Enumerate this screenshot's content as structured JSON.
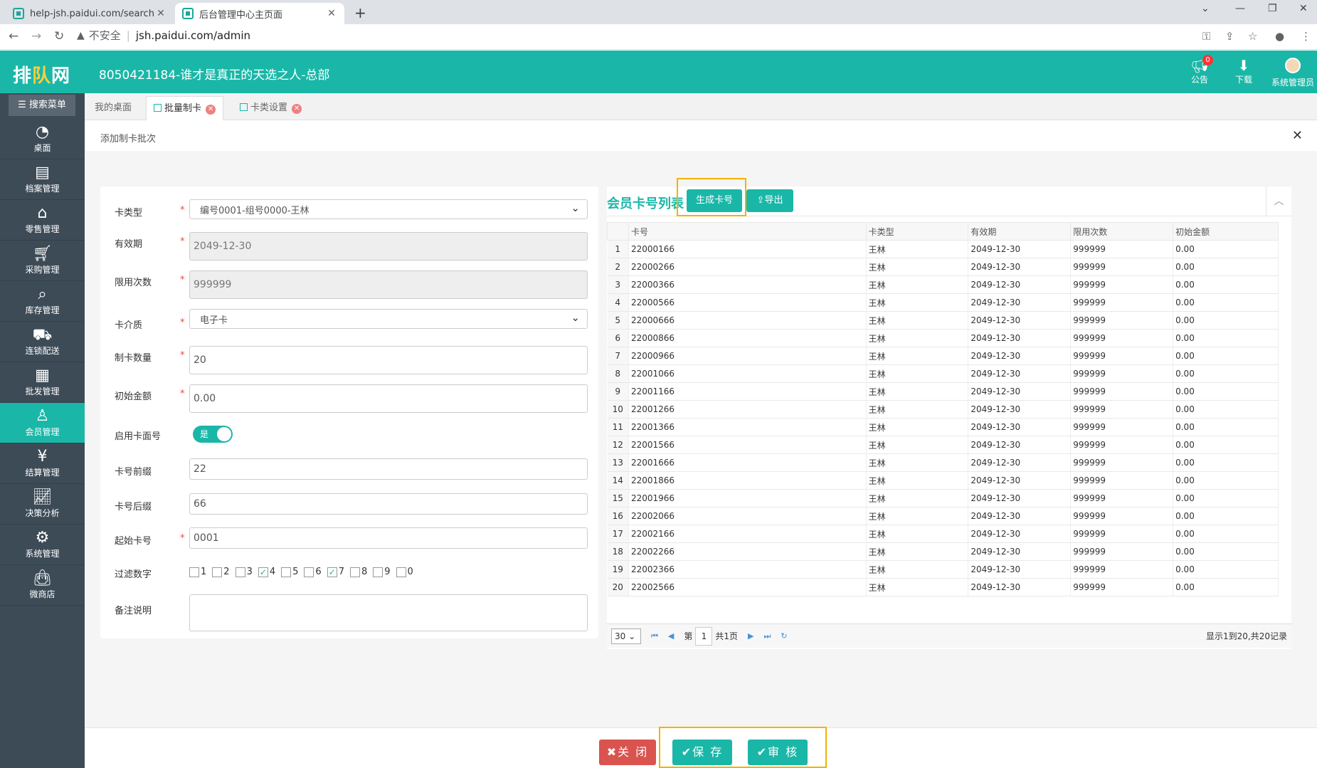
{
  "browser": {
    "tabs": [
      {
        "title": "help-jsh.paidui.com/search?ke"
      },
      {
        "title": "后台管理中心主页面"
      }
    ],
    "url_warning": "不安全",
    "url": "jsh.paidui.com/admin"
  },
  "header": {
    "logo": "排队网",
    "title": "8050421184-谁才是真正的天选之人-总部",
    "notice_label": "公告",
    "notice_count": "0",
    "download_label": "下载",
    "user_label": "系统管理员"
  },
  "sidebar": {
    "search_label": "搜索菜单",
    "items": [
      {
        "label": "桌面",
        "icon": "dashboard-icon"
      },
      {
        "label": "档案管理",
        "icon": "archive-icon"
      },
      {
        "label": "零售管理",
        "icon": "store-icon"
      },
      {
        "label": "采购管理",
        "icon": "cart-icon"
      },
      {
        "label": "库存管理",
        "icon": "inventory-icon"
      },
      {
        "label": "连锁配送",
        "icon": "truck-icon"
      },
      {
        "label": "批发管理",
        "icon": "wholesale-icon"
      },
      {
        "label": "会员管理",
        "icon": "member-icon"
      },
      {
        "label": "结算管理",
        "icon": "settlement-icon"
      },
      {
        "label": "决策分析",
        "icon": "chart-icon"
      },
      {
        "label": "系统管理",
        "icon": "gear-icon"
      },
      {
        "label": "微商店",
        "icon": "bag-icon"
      }
    ],
    "active_index": 7
  },
  "page_tabs": [
    {
      "label": "我的桌面"
    },
    {
      "label": "批量制卡"
    },
    {
      "label": "卡类设置"
    }
  ],
  "panel": {
    "title": "添加制卡批次"
  },
  "form": {
    "card_type": {
      "label": "卡类型",
      "value": "编号0001-组号0000-王林"
    },
    "expiry": {
      "label": "有效期",
      "value": "2049-12-30"
    },
    "limit_times": {
      "label": "限用次数",
      "value": "999999"
    },
    "medium": {
      "label": "卡介质",
      "value": "电子卡"
    },
    "quantity": {
      "label": "制卡数量",
      "value": "20"
    },
    "initial_amount": {
      "label": "初始金额",
      "value": "0.00"
    },
    "face_no": {
      "label": "启用卡面号",
      "value": "是"
    },
    "prefix": {
      "label": "卡号前缀",
      "value": "22"
    },
    "suffix": {
      "label": "卡号后缀",
      "value": "66"
    },
    "start_no": {
      "label": "起始卡号",
      "value": "0001"
    },
    "filter": {
      "label": "过滤数字",
      "options": [
        {
          "digit": "1",
          "checked": false
        },
        {
          "digit": "2",
          "checked": false
        },
        {
          "digit": "3",
          "checked": false
        },
        {
          "digit": "4",
          "checked": true
        },
        {
          "digit": "5",
          "checked": false
        },
        {
          "digit": "6",
          "checked": false
        },
        {
          "digit": "7",
          "checked": true
        },
        {
          "digit": "8",
          "checked": false
        },
        {
          "digit": "9",
          "checked": false
        },
        {
          "digit": "0",
          "checked": false
        }
      ]
    },
    "remark": {
      "label": "备注说明",
      "value": ""
    }
  },
  "card_list": {
    "title": "会员卡号列表",
    "generate_label": "生成卡号",
    "export_label": "导出",
    "columns": [
      "卡号",
      "卡类型",
      "有效期",
      "限用次数",
      "初始金额"
    ],
    "rows": [
      [
        "22000166",
        "王林",
        "2049-12-30",
        "999999",
        "0.00"
      ],
      [
        "22000266",
        "王林",
        "2049-12-30",
        "999999",
        "0.00"
      ],
      [
        "22000366",
        "王林",
        "2049-12-30",
        "999999",
        "0.00"
      ],
      [
        "22000566",
        "王林",
        "2049-12-30",
        "999999",
        "0.00"
      ],
      [
        "22000666",
        "王林",
        "2049-12-30",
        "999999",
        "0.00"
      ],
      [
        "22000866",
        "王林",
        "2049-12-30",
        "999999",
        "0.00"
      ],
      [
        "22000966",
        "王林",
        "2049-12-30",
        "999999",
        "0.00"
      ],
      [
        "22001066",
        "王林",
        "2049-12-30",
        "999999",
        "0.00"
      ],
      [
        "22001166",
        "王林",
        "2049-12-30",
        "999999",
        "0.00"
      ],
      [
        "22001266",
        "王林",
        "2049-12-30",
        "999999",
        "0.00"
      ],
      [
        "22001366",
        "王林",
        "2049-12-30",
        "999999",
        "0.00"
      ],
      [
        "22001566",
        "王林",
        "2049-12-30",
        "999999",
        "0.00"
      ],
      [
        "22001666",
        "王林",
        "2049-12-30",
        "999999",
        "0.00"
      ],
      [
        "22001866",
        "王林",
        "2049-12-30",
        "999999",
        "0.00"
      ],
      [
        "22001966",
        "王林",
        "2049-12-30",
        "999999",
        "0.00"
      ],
      [
        "22002066",
        "王林",
        "2049-12-30",
        "999999",
        "0.00"
      ],
      [
        "22002166",
        "王林",
        "2049-12-30",
        "999999",
        "0.00"
      ],
      [
        "22002266",
        "王林",
        "2049-12-30",
        "999999",
        "0.00"
      ],
      [
        "22002366",
        "王林",
        "2049-12-30",
        "999999",
        "0.00"
      ],
      [
        "22002566",
        "王林",
        "2049-12-30",
        "999999",
        "0.00"
      ]
    ],
    "pager": {
      "page_size": "30",
      "page_prefix": "第",
      "page": "1",
      "total_pages": "共1页",
      "info": "显示1到20,共20记录"
    }
  },
  "footer": {
    "close_label": "✖关 闭",
    "save_label": "✔保 存",
    "audit_label": "✔审 核"
  },
  "colors": {
    "brand": "#1ab7a8",
    "sidebar": "#3d4b57",
    "highlight": "#f3b200",
    "danger": "#d9534f"
  }
}
